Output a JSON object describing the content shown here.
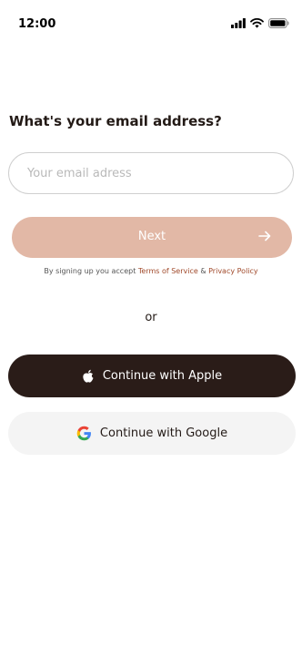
{
  "status_bar": {
    "time": "12:00"
  },
  "signup": {
    "heading": "What's your email address?",
    "email_placeholder": "Your email adress",
    "email_value": "",
    "next_label": "Next",
    "terms_prefix": "By signing up you accept ",
    "terms_link": "Terms of Service",
    "terms_joiner": " & ",
    "privacy_link": "Privacy Policy",
    "or_label": "or",
    "apple_label": "Continue with Apple",
    "google_label": "Continue with Google"
  },
  "icons": {
    "status": [
      "signal-icon",
      "wifi-icon",
      "battery-icon"
    ],
    "next": "arrow-right-icon",
    "apple": "apple-logo-icon",
    "google": "google-logo-icon"
  },
  "colors": {
    "primary": "#e2b8a6",
    "dark": "#2a1c18",
    "link": "#a0492a",
    "light_button": "#f4f4f4"
  }
}
